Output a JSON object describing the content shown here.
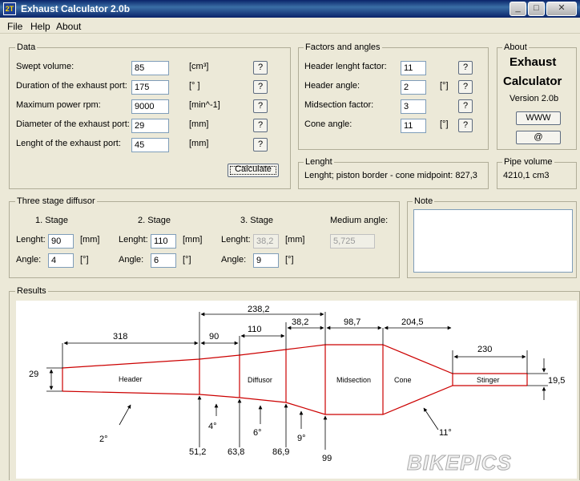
{
  "window": {
    "title": "Exhaust Calculator 2.0b",
    "icon_text": "2T"
  },
  "menu": [
    "File",
    "Help",
    "About"
  ],
  "data_group": {
    "title": "Data",
    "rows": [
      {
        "label": "Swept volume:",
        "value": "85",
        "unit": "[cm³]"
      },
      {
        "label": "Duration of the exhaust port:",
        "value": "175",
        "unit": "[° ]"
      },
      {
        "label": "Maximum power rpm:",
        "value": "9000",
        "unit": "[min^-1]"
      },
      {
        "label": "Diameter of the exhaust port:",
        "value": "29",
        "unit": "[mm]"
      },
      {
        "label": "Lenght of the exhaust port:",
        "value": "45",
        "unit": "[mm]"
      }
    ],
    "help_label": "?",
    "calculate_label": "Calculate"
  },
  "factors_group": {
    "title": "Factors and angles",
    "rows": [
      {
        "label": "Header lenght factor:",
        "value": "11",
        "unit": ""
      },
      {
        "label": "Header angle:",
        "value": "2",
        "unit": "[°]"
      },
      {
        "label": "Midsection factor:",
        "value": "3",
        "unit": ""
      },
      {
        "label": "Cone angle:",
        "value": "11",
        "unit": "[°]"
      }
    ]
  },
  "about_group": {
    "title": "About",
    "line1": "Exhaust",
    "line2": "Calculator",
    "version": "Version 2.0b",
    "www_label": "WWW",
    "mail_label": "@"
  },
  "length_group": {
    "title": "Lenght",
    "text": "Lenght; piston border - cone midpoint:  827,3"
  },
  "pipe_group": {
    "title": "Pipe volume",
    "text": "4210,1 cm3"
  },
  "diffusor_group": {
    "title": "Three stage diffusor",
    "stages": [
      {
        "heading": "1. Stage",
        "lenght_label": "Lenght:",
        "lenght": "90",
        "unit": "[mm]",
        "angle_label": "Angle:",
        "angle": "4",
        "angle_unit": "[°]"
      },
      {
        "heading": "2. Stage",
        "lenght_label": "Lenght:",
        "lenght": "110",
        "unit": "[mm]",
        "angle_label": "Angle:",
        "angle": "6",
        "angle_unit": "[°]"
      },
      {
        "heading": "3. Stage",
        "lenght_label": "Lenght:",
        "lenght": "38,2",
        "unit": "[mm]",
        "angle_label": "Angle:",
        "angle": "9",
        "angle_unit": "[°]"
      }
    ],
    "medium_angle_label": "Medium angle:",
    "medium_angle": "5,725"
  },
  "note_group": {
    "title": "Note",
    "text": ""
  },
  "results": {
    "title": "Results",
    "sections": [
      "Header",
      "Diffusor",
      "Midsection",
      "Cone",
      "Stinger"
    ],
    "top_dims": [
      "318",
      "90",
      "110",
      "38,2",
      "98,7",
      "204,5",
      "238,2",
      "230"
    ],
    "left_dim": "29",
    "right_dim": "19,5",
    "bottom_dims": [
      "51,2",
      "63,8",
      "86,9",
      "99"
    ],
    "angles": [
      "2°",
      "4°",
      "6°",
      "9°",
      "11°"
    ],
    "watermark": "BIKEPICS"
  }
}
